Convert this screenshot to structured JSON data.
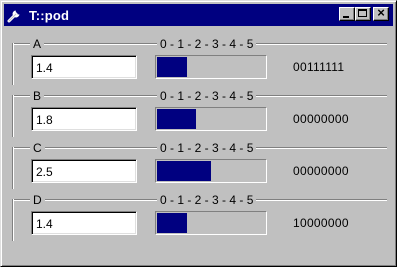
{
  "window": {
    "title": "T::pod",
    "icon": "wrench-icon"
  },
  "scale_label": "0 - 1 - 2 - 3 - 4 - 5",
  "channels": [
    {
      "label": "A",
      "value": "1.4",
      "level": 1.4,
      "bits": "00111111"
    },
    {
      "label": "B",
      "value": "1.8",
      "level": 1.8,
      "bits": "00000000"
    },
    {
      "label": "C",
      "value": "2.5",
      "level": 2.5,
      "bits": "00000000"
    },
    {
      "label": "D",
      "value": "1.4",
      "level": 1.4,
      "bits": "10000000"
    }
  ],
  "meter_max": 5,
  "colors": {
    "titlebar": "#000080",
    "meter_fill": "#000080",
    "face": "#c0c0c0"
  }
}
